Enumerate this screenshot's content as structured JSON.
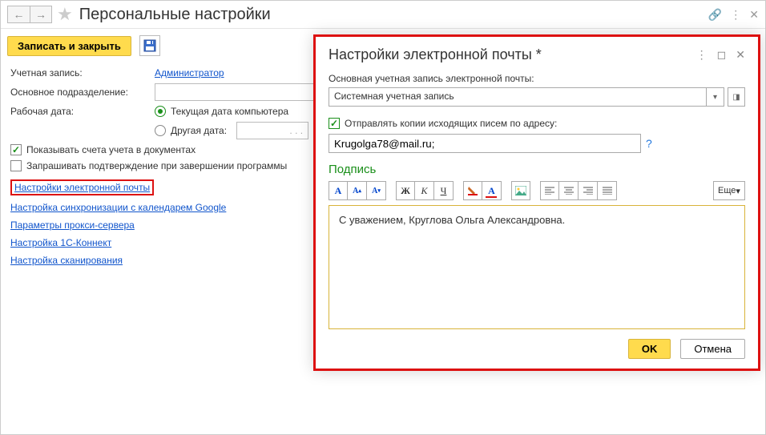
{
  "header": {
    "title": "Персональные настройки"
  },
  "toolbar": {
    "save_close_label": "Записать и закрыть"
  },
  "form": {
    "account_label": "Учетная запись:",
    "account_value": "Администратор",
    "dept_label": "Основное подразделение:",
    "workdate_label": "Рабочая дата:",
    "radio_current": "Текущая дата компьютера",
    "radio_other": "Другая дата:",
    "date_placeholder": ". . .",
    "cb_show_accounts": "Показывать счета учета в документах",
    "cb_confirm_exit": "Запрашивать подтверждение при завершении программы"
  },
  "links": {
    "email": "Настройки электронной почты",
    "google": "Настройка синхронизации с календарем Google",
    "proxy": "Параметры прокси-сервера",
    "connect": "Настройка 1С-Коннект",
    "scan": "Настройка сканирования"
  },
  "modal": {
    "title": "Настройки электронной почты *",
    "main_account_label": "Основная учетная запись электронной почты:",
    "main_account_value": "Системная учетная запись",
    "cb_send_copies": "Отправлять копии исходящих писем по адресу:",
    "email_value": "Krugolga78@mail.ru;",
    "signature_label": "Подпись",
    "more_btn": "Еще",
    "signature_text": "С уважением, Круглова Ольга Александровна.",
    "ok": "OK",
    "cancel": "Отмена"
  },
  "rte": {
    "fontA": "A",
    "bold": "Ж",
    "italic": "К",
    "underline": "Ч"
  }
}
